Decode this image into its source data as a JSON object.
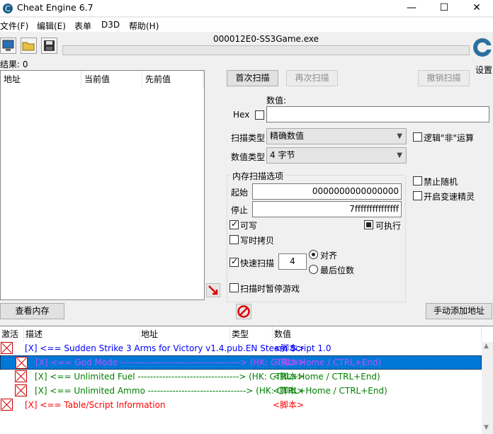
{
  "window": {
    "title": "Cheat Engine 6.7",
    "minimize": "—",
    "maximize": "☐",
    "close": "✕"
  },
  "menu": [
    "文件(F)",
    "编辑(E)",
    "表单",
    "D3D",
    "帮助(H)"
  ],
  "process_name": "000012E0-SS3Game.exe",
  "settings_label": "设置",
  "found_label": "结果: 0",
  "result_columns": [
    "地址",
    "当前值",
    "先前值"
  ],
  "buttons": {
    "first_scan": "首次扫描",
    "next_scan": "再次扫描",
    "undo_scan": "撤销扫描",
    "view_memory": "查看内存",
    "add_address": "手动添加地址"
  },
  "value_label": "数值:",
  "hex_label": "Hex",
  "scan_type_label": "扫描类型",
  "scan_type_value": "精确数值",
  "value_type_label": "数值类型",
  "value_type_value": "4 字节",
  "logic_not_label": "逻辑\"非\"运算",
  "memory_options_label": "内存扫描选项",
  "start_label": "起始",
  "start_value": "0000000000000000",
  "stop_label": "停止",
  "stop_value": "7fffffffffffffff",
  "writable_label": "可写",
  "executable_label": "可执行",
  "copy_on_write_label": "写时拷贝",
  "fast_scan_label": "快速扫描",
  "fast_scan_value": "4",
  "align_label": "对齐",
  "last_digit_label": "最后位数",
  "pause_label": "扫描时暂停游戏",
  "no_random_label": "禁止随机",
  "speedhack_label": "开启变速精灵",
  "table_columns": [
    "激活",
    "描述",
    "地址",
    "类型",
    "数值"
  ],
  "rows": [
    {
      "desc": "[X] <== Sudden Strike 3 Arms for Victory v1.4.pub.EN Steam Script 1.0",
      "value": "<脚本>",
      "color": "#0000ff"
    },
    {
      "desc": "[X] <== God Mode ---------------------------------------> (HK: CTRL+Home / CTRL+End)",
      "value": "<脚本>",
      "color": "#a000c8"
    },
    {
      "desc": "[X] <== Unlimited Fuel  ---------------------------------> (HK: CTRL+Home / CTRL+End)",
      "value": "<脚本>",
      "color": "#008000"
    },
    {
      "desc": "[X] <== Unlimited Ammo  --------------------------------> (HK: CTRL+Home / CTRL+End)",
      "value": "<脚本>",
      "color": "#008000"
    },
    {
      "desc": "[X] <== Table/Script Information",
      "value": "<脚本>",
      "color": "#ff0000"
    }
  ]
}
